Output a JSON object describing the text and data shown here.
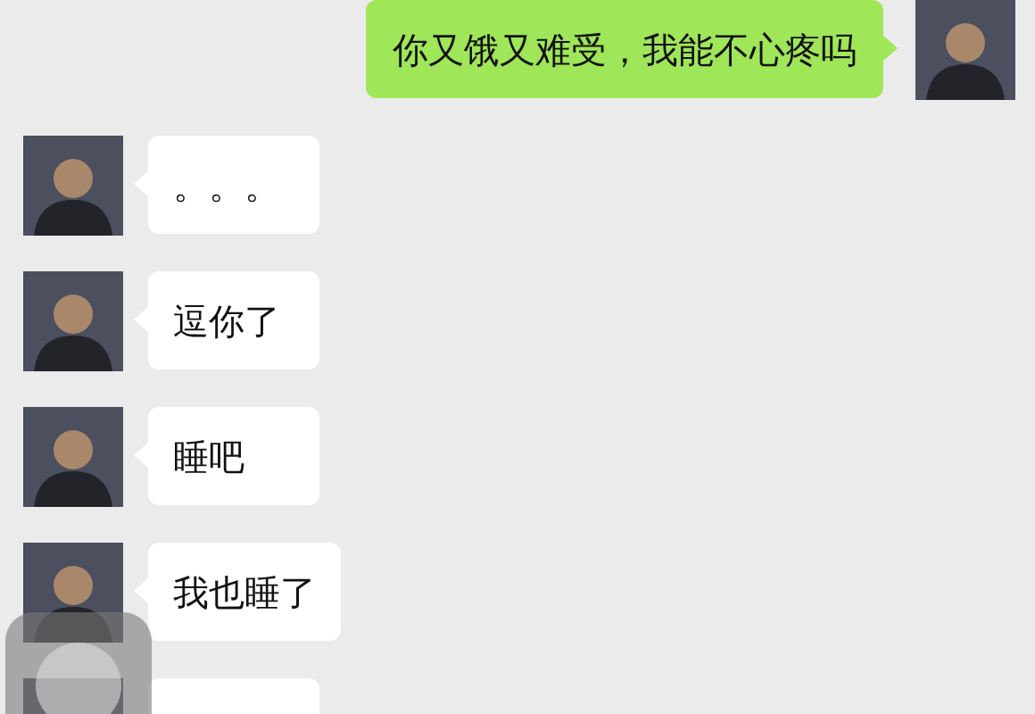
{
  "messages": [
    {
      "kind": "sent",
      "text": "你又饿又难受，我能不心疼吗"
    },
    {
      "kind": "received",
      "text": "。。。"
    },
    {
      "kind": "received",
      "text": "逗你了"
    },
    {
      "kind": "received",
      "text": "睡吧"
    },
    {
      "kind": "received",
      "text": "我也睡了"
    },
    {
      "kind": "received"
    }
  ]
}
